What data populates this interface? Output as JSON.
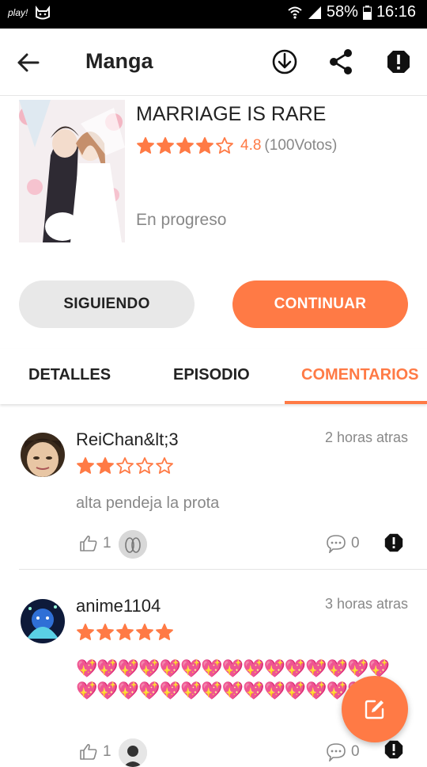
{
  "status_bar": {
    "app_label": "play!",
    "battery": "58%",
    "time": "16:16"
  },
  "appbar": {
    "title": "Manga"
  },
  "manga": {
    "title": "MARRIAGE IS RARE",
    "rating_stars": 4,
    "score": "4.8",
    "votes": "(100Votos)",
    "status": "En progreso"
  },
  "buttons": {
    "follow": "SIGUIENDO",
    "continue": "CONTINUAR"
  },
  "tabs": [
    {
      "label": "DETALLES",
      "active": false
    },
    {
      "label": "EPISODIO",
      "active": false
    },
    {
      "label": "COMENTARIOS",
      "active": true
    }
  ],
  "comments": [
    {
      "user": "ReiChan&lt;3",
      "time": "2 horas atras",
      "stars": 2,
      "text": "alta pendeja la prota",
      "likes": "1",
      "replies": "0"
    },
    {
      "user": "anime1104",
      "time": "3 horas atras",
      "stars": 5,
      "text": "💖💖💖💖💖💖💖💖💖💖💖💖💖💖💖💖💖💖💖💖💖💖💖💖💖💖💖💖💖💖",
      "likes": "1",
      "replies": "0"
    }
  ],
  "colors": {
    "accent": "#ff7a45",
    "text": "#222222",
    "muted": "#888888"
  }
}
